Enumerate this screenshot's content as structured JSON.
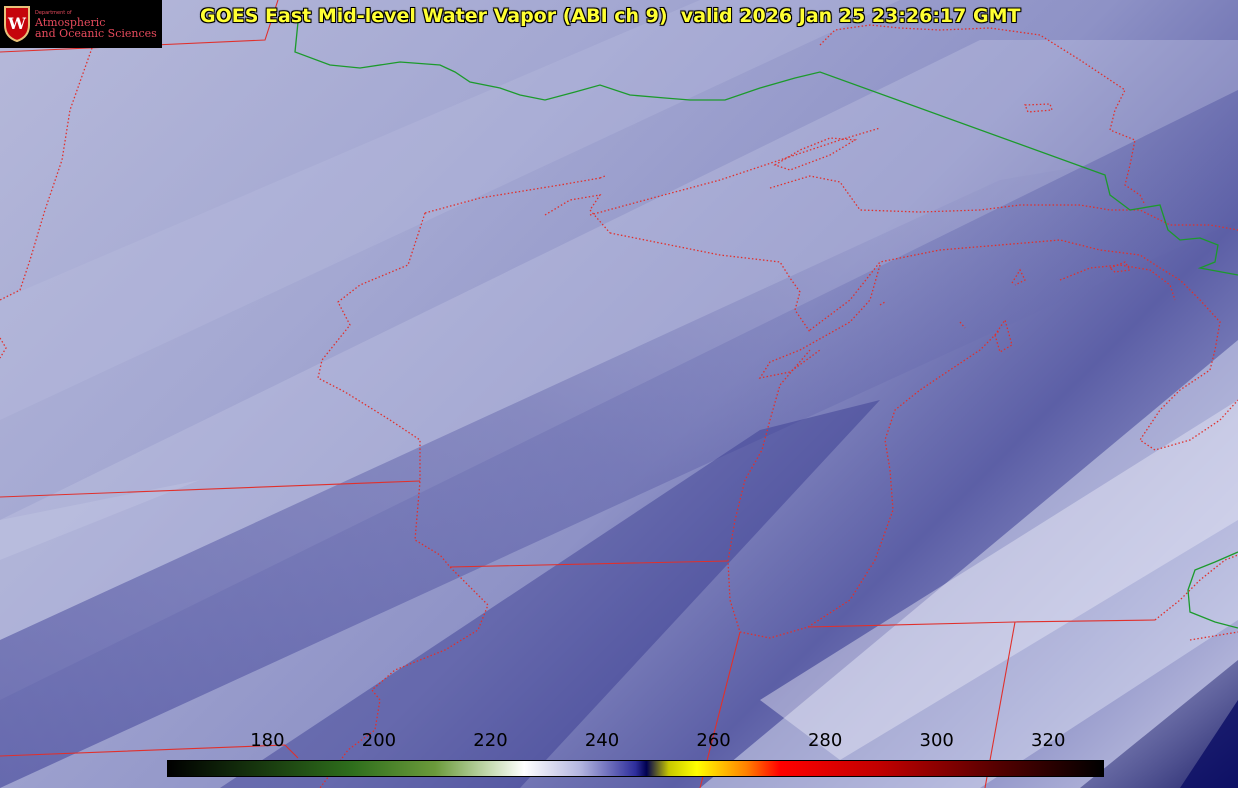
{
  "title": {
    "text": "GOES East Mid-level Water Vapor (ABI ch 9)  valid 2026 Jan 25 23:26:17 GMT"
  },
  "logo": {
    "dept": "Department of",
    "line1": "Atmospheric",
    "line2": "and Oceanic Sciences",
    "icon": "uw-crest-icon",
    "letter": "W"
  },
  "colorbar": {
    "min": 162,
    "max": 330,
    "ticks": [
      "180",
      "200",
      "220",
      "240",
      "260",
      "280",
      "300",
      "320"
    ],
    "tick_values": [
      180,
      200,
      220,
      240,
      260,
      280,
      300,
      320
    ],
    "stops": [
      {
        "value": 162,
        "color": "#000000"
      },
      {
        "value": 195,
        "color": "#2e6e1c"
      },
      {
        "value": 210,
        "color": "#6b9a3b"
      },
      {
        "value": 220,
        "color": "#c8dcb4"
      },
      {
        "value": 226,
        "color": "#ffffff"
      },
      {
        "value": 236,
        "color": "#b4b6e0"
      },
      {
        "value": 246,
        "color": "#2e2e9c"
      },
      {
        "value": 248,
        "color": "#000050"
      },
      {
        "value": 252,
        "color": "#c8c800"
      },
      {
        "value": 257,
        "color": "#ffff00"
      },
      {
        "value": 266,
        "color": "#ff8000"
      },
      {
        "value": 272,
        "color": "#ff0000"
      },
      {
        "value": 290,
        "color": "#c00000"
      },
      {
        "value": 312,
        "color": "#500000"
      },
      {
        "value": 330,
        "color": "#000000"
      }
    ]
  },
  "map": {
    "state_border_color": "#e0302c",
    "country_border_color": "#1c9a2c",
    "map_features": [
      "water-vapor-imagery",
      "state-borders",
      "coastlines",
      "international-border"
    ]
  }
}
